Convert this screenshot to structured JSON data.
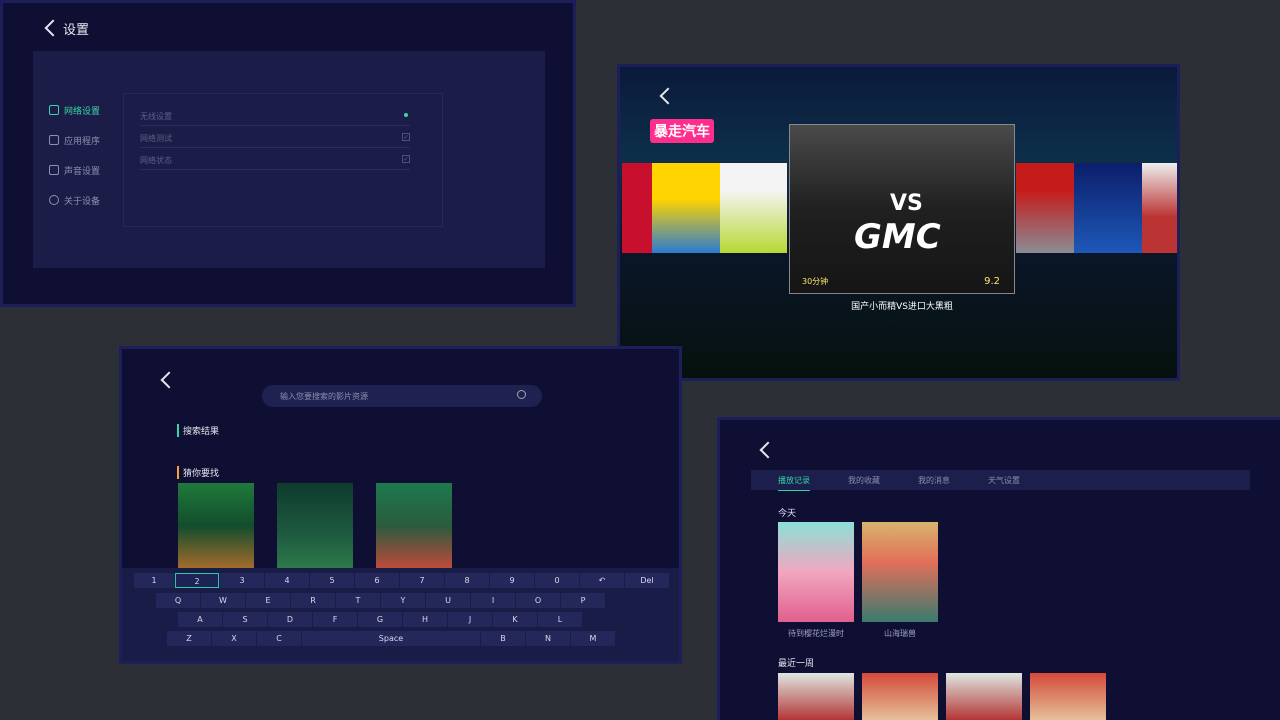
{
  "settings": {
    "title": "设置",
    "menu": [
      {
        "label": "网络设置",
        "icon": "wifi-icon",
        "active": true
      },
      {
        "label": "应用程序",
        "icon": "apps-icon",
        "active": false
      },
      {
        "label": "声音设置",
        "icon": "speaker-icon",
        "active": false
      },
      {
        "label": "关于设备",
        "icon": "info-icon",
        "active": false
      }
    ],
    "rows": [
      "无线设置",
      "网络测试",
      "网络状态"
    ]
  },
  "car": {
    "brand": "暴走汽车",
    "main_vs": "VS",
    "main_title": "GMC",
    "duration": "30分钟",
    "score": "9.2",
    "caption": "国产小而精VS进口大黑粗"
  },
  "search": {
    "placeholder": "输入您要搜索的影片资源",
    "section_results": "搜索结果",
    "section_guess": "猜你要找",
    "keys_row1": [
      "1",
      "2",
      "3",
      "4",
      "5",
      "6",
      "7",
      "8",
      "9",
      "0",
      "↶",
      "Del"
    ],
    "keys_row2": [
      "Q",
      "W",
      "E",
      "R",
      "T",
      "Y",
      "U",
      "I",
      "O",
      "P"
    ],
    "keys_row3": [
      "A",
      "S",
      "D",
      "F",
      "G",
      "H",
      "J",
      "K",
      "L"
    ],
    "keys_row4": [
      "Z",
      "X",
      "C",
      "Space",
      "B",
      "N",
      "M"
    ]
  },
  "history": {
    "tabs": [
      "播放记录",
      "我的收藏",
      "我的消息",
      "天气设置"
    ],
    "today": "今天",
    "week": "最近一周",
    "today_items": [
      "待到樱花烂漫时",
      "山海瑞兽"
    ]
  },
  "colors": {
    "accent": "#2fd6a3",
    "bg": "#0f0f33",
    "panel": "#1b1d48",
    "tag": "#ff2d8c"
  }
}
